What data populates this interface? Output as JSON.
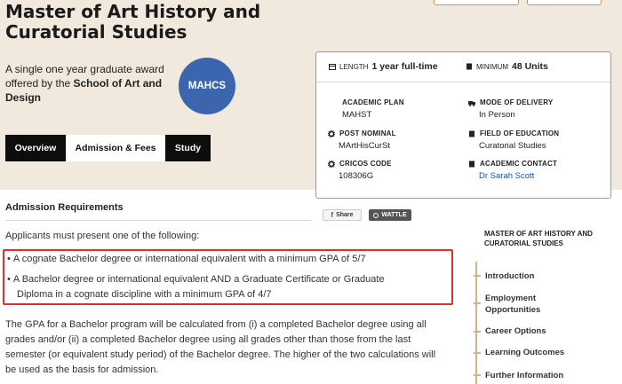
{
  "hero": {
    "title": "Master of Art History and Curatorial Studies",
    "desc_prefix": "A single one year graduate award offered by the ",
    "desc_school": "School of Art and Design",
    "badge": "MAHCS"
  },
  "tabs": [
    {
      "label": "Overview",
      "active": false
    },
    {
      "label": "Admission & Fees",
      "active": true
    },
    {
      "label": "Study",
      "active": false
    }
  ],
  "info": {
    "length_label": "LENGTH",
    "length_value": "1 year full-time",
    "minimum_label": "MINIMUM",
    "minimum_value": "48 Units",
    "fields": [
      {
        "label": "ACADEMIC PLAN",
        "value": "MAHST",
        "icon": "none"
      },
      {
        "label": "MODE OF DELIVERY",
        "value": "In Person",
        "icon": "truck-icon"
      },
      {
        "label": "POST NOMINAL",
        "value": "MArtHisCurSt",
        "icon": "gear-icon"
      },
      {
        "label": "FIELD OF EDUCATION",
        "value": "Curatorial Studies",
        "icon": "book-icon"
      },
      {
        "label": "CRICOS CODE",
        "value": "108306G",
        "icon": "gear-icon"
      },
      {
        "label": "ACADEMIC CONTACT",
        "value": "Dr Sarah Scott",
        "icon": "book-icon"
      }
    ]
  },
  "admission": {
    "heading": "Admission Requirements",
    "share_fb": "Share",
    "share_wt": "WATTLE",
    "intro": "Applicants must present one of the following:",
    "req1": "A cognate Bachelor degree or international equivalent with a minimum GPA of 5/7",
    "req2_line1": "A Bachelor degree or international equivalent AND a Graduate Certificate or Graduate",
    "req2_line2": "Diploma in a cognate discipline with a minimum GPA of 4/7",
    "gpa_paragraph": "The GPA for a Bachelor program will be calculated from (i) a completed Bachelor degree using all grades and/or (ii) a completed Bachelor degree using all grades other than those from the last semester (or equivalent study period) of the Bachelor degree. The higher of the two calculations will be used as the basis for admission."
  },
  "sidebar": {
    "heading": "MASTER OF ART HISTORY AND CURATORIAL STUDIES",
    "items": [
      {
        "label": "Introduction"
      },
      {
        "label": "Employment Opportunities"
      },
      {
        "label": "Career Options"
      },
      {
        "label": "Learning Outcomes"
      },
      {
        "label": "Further Information"
      }
    ]
  },
  "colors": {
    "badge": "#3b66ad",
    "accent": "#c9974a",
    "highlight_box": "#d83232",
    "link": "#1c4fa0"
  }
}
